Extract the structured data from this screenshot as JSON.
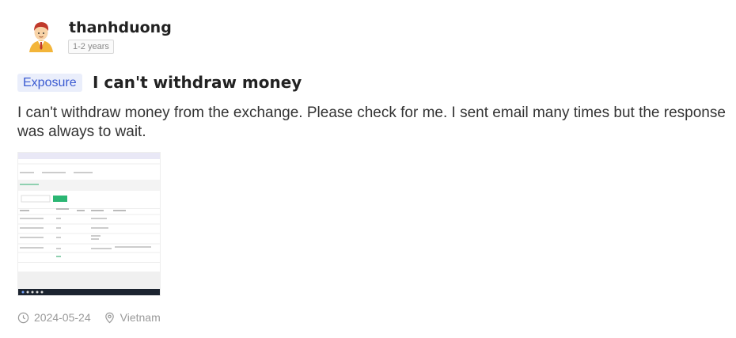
{
  "author": {
    "username": "thanhduong",
    "tenure": "1-2 years",
    "avatar_icon": "user-avatar-icon"
  },
  "post": {
    "tag": "Exposure",
    "title": "I can't withdraw money",
    "body": "I can't withdraw money from the exchange. Please check for me. I sent email many times but the response was always to wait.",
    "attachment_icon": "screenshot-thumbnail"
  },
  "meta": {
    "date": "2024-05-24",
    "location": "Vietnam",
    "date_icon": "clock-icon",
    "location_icon": "location-pin-icon"
  },
  "colors": {
    "tag_bg": "#eaeefb",
    "tag_text": "#3a5ad1",
    "thumb_accent": "#2bb673"
  }
}
